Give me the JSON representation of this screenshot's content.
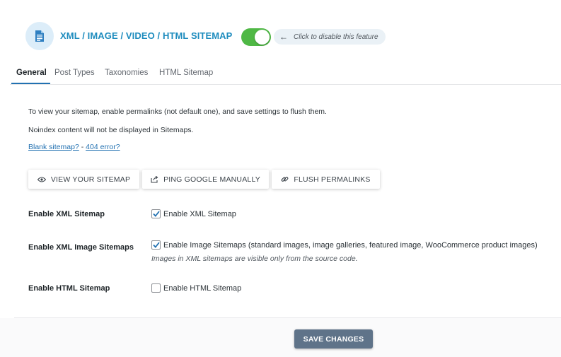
{
  "header": {
    "title": "XML / IMAGE / VIDEO / HTML SITEMAP",
    "icon": "document-icon",
    "toggle_on": true,
    "toggle_hint": "Click to disable this feature",
    "accent_color": "#1e8cbe",
    "toggle_color": "#4fb845"
  },
  "tabs": [
    {
      "label": "General",
      "active": true
    },
    {
      "label": "Post Types",
      "active": false
    },
    {
      "label": "Taxonomies",
      "active": false
    },
    {
      "label": "HTML Sitemap",
      "active": false
    }
  ],
  "main": {
    "info_1": "To view your sitemap, enable permalinks (not default one), and save settings to flush them.",
    "info_2": "Noindex content will not be displayed in Sitemaps.",
    "link_blank": "Blank sitemap?",
    "link_separator": " - ",
    "link_404": "404 error?",
    "buttons": {
      "view": "VIEW YOUR SITEMAP",
      "ping": "PING GOOGLE MANUALLY",
      "flush": "FLUSH PERMALINKS"
    },
    "settings": {
      "xml": {
        "label": "Enable XML Sitemap",
        "checkbox_label": "Enable XML Sitemap",
        "checked": true
      },
      "image": {
        "label": "Enable XML Image Sitemaps",
        "checkbox_label": "Enable Image Sitemaps (standard images, image galleries, featured image, WooCommerce product images)",
        "checked": true,
        "note": "Images in XML sitemaps are visible only from the source code."
      },
      "html": {
        "label": "Enable HTML Sitemap",
        "checkbox_label": "Enable HTML Sitemap",
        "checked": false
      }
    }
  },
  "footer": {
    "save_label": "SAVE CHANGES",
    "save_color": "#5f7389"
  }
}
